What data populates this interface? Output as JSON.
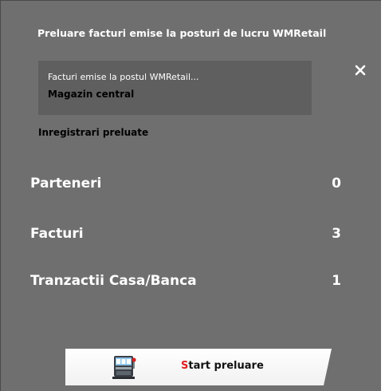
{
  "dialog": {
    "title": "Preluare facturi emise la posturi de lucru WMRetail",
    "close_symbol": "✕"
  },
  "source": {
    "description": "Facturi emise la postul WMRetail...",
    "location": "Magazin central"
  },
  "summary": {
    "heading": "Inregistrari preluate",
    "rows": [
      {
        "label": "Parteneri",
        "value": "0"
      },
      {
        "label": "Facturi",
        "value": "3"
      },
      {
        "label": "Tranzactii Casa/Banca",
        "value": "1"
      }
    ]
  },
  "start_button": {
    "label_first": "S",
    "label_rest": "tart preluare",
    "icon": "pos-terminal-icon"
  },
  "colors": {
    "panel_bg": "#6f6f6f",
    "info_box_bg": "#5f5f5f",
    "accent_letter": "#e02020"
  }
}
